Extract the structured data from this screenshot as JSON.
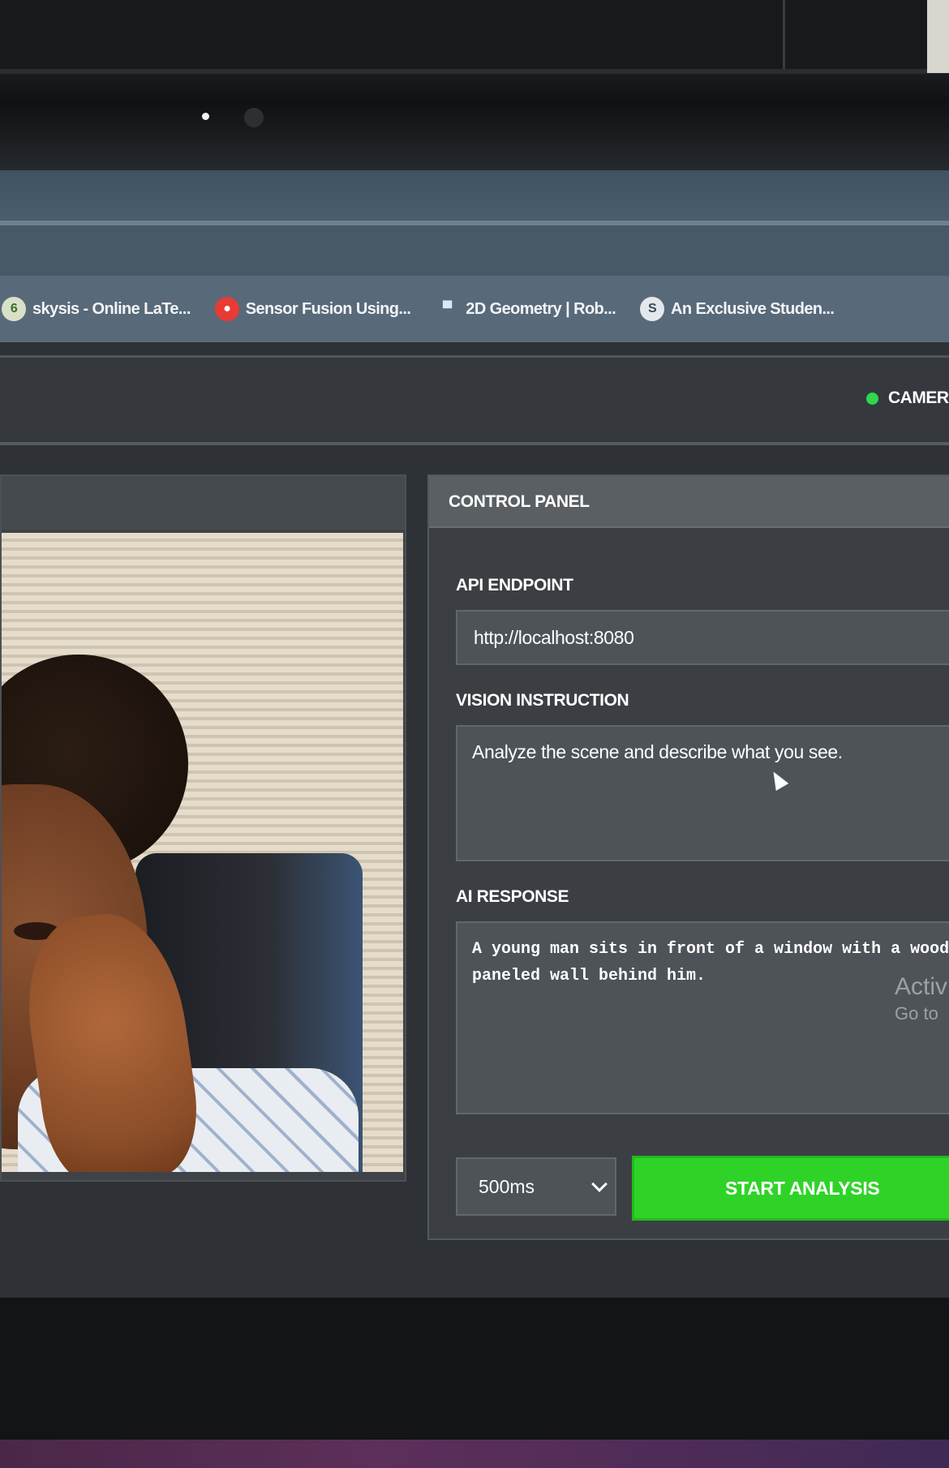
{
  "bookmarks": [
    {
      "label": "skysis - Online LaTe...",
      "icon": "overleaf-icon",
      "glyph": "6"
    },
    {
      "label": "Sensor Fusion Using...",
      "icon": "youtube-icon",
      "glyph": "●"
    },
    {
      "label": "2D Geometry | Rob...",
      "icon": "robot-icon",
      "glyph": "▀"
    },
    {
      "label": "An Exclusive Studen...",
      "icon": "scribd-icon",
      "glyph": "S"
    }
  ],
  "header": {
    "status_label": "CAMER",
    "status_color": "#2ed84a"
  },
  "control_panel": {
    "title": "CONTROL PANEL",
    "api_endpoint_label": "API ENDPOINT",
    "api_endpoint_value": "http://localhost:8080",
    "vision_instruction_label": "VISION INSTRUCTION",
    "vision_instruction_value": "Analyze the scene and describe what you see.",
    "ai_response_label": "AI RESPONSE",
    "ai_response_value": " A young man sits in front of a window with a wood paneled wall behind him.",
    "interval_value": "500ms",
    "start_button_label": "START ANALYSIS",
    "accent_color": "#2fd328"
  },
  "watermark": {
    "line1": "Activ",
    "line2": "Go to"
  }
}
